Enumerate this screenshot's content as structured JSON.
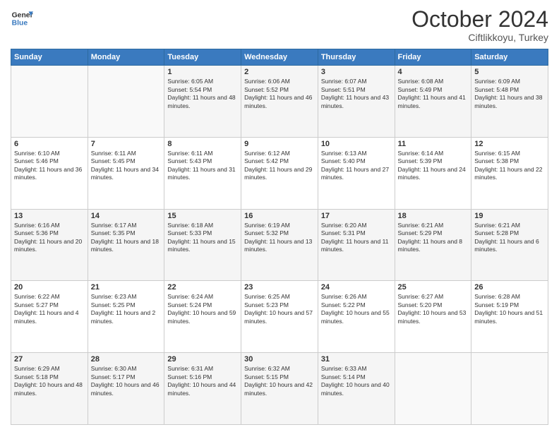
{
  "header": {
    "logo_line1": "General",
    "logo_line2": "Blue",
    "month": "October 2024",
    "location": "Ciftlikkoyu, Turkey"
  },
  "days_of_week": [
    "Sunday",
    "Monday",
    "Tuesday",
    "Wednesday",
    "Thursday",
    "Friday",
    "Saturday"
  ],
  "weeks": [
    [
      {
        "num": "",
        "info": ""
      },
      {
        "num": "",
        "info": ""
      },
      {
        "num": "1",
        "info": "Sunrise: 6:05 AM\nSunset: 5:54 PM\nDaylight: 11 hours and 48 minutes."
      },
      {
        "num": "2",
        "info": "Sunrise: 6:06 AM\nSunset: 5:52 PM\nDaylight: 11 hours and 46 minutes."
      },
      {
        "num": "3",
        "info": "Sunrise: 6:07 AM\nSunset: 5:51 PM\nDaylight: 11 hours and 43 minutes."
      },
      {
        "num": "4",
        "info": "Sunrise: 6:08 AM\nSunset: 5:49 PM\nDaylight: 11 hours and 41 minutes."
      },
      {
        "num": "5",
        "info": "Sunrise: 6:09 AM\nSunset: 5:48 PM\nDaylight: 11 hours and 38 minutes."
      }
    ],
    [
      {
        "num": "6",
        "info": "Sunrise: 6:10 AM\nSunset: 5:46 PM\nDaylight: 11 hours and 36 minutes."
      },
      {
        "num": "7",
        "info": "Sunrise: 6:11 AM\nSunset: 5:45 PM\nDaylight: 11 hours and 34 minutes."
      },
      {
        "num": "8",
        "info": "Sunrise: 6:11 AM\nSunset: 5:43 PM\nDaylight: 11 hours and 31 minutes."
      },
      {
        "num": "9",
        "info": "Sunrise: 6:12 AM\nSunset: 5:42 PM\nDaylight: 11 hours and 29 minutes."
      },
      {
        "num": "10",
        "info": "Sunrise: 6:13 AM\nSunset: 5:40 PM\nDaylight: 11 hours and 27 minutes."
      },
      {
        "num": "11",
        "info": "Sunrise: 6:14 AM\nSunset: 5:39 PM\nDaylight: 11 hours and 24 minutes."
      },
      {
        "num": "12",
        "info": "Sunrise: 6:15 AM\nSunset: 5:38 PM\nDaylight: 11 hours and 22 minutes."
      }
    ],
    [
      {
        "num": "13",
        "info": "Sunrise: 6:16 AM\nSunset: 5:36 PM\nDaylight: 11 hours and 20 minutes."
      },
      {
        "num": "14",
        "info": "Sunrise: 6:17 AM\nSunset: 5:35 PM\nDaylight: 11 hours and 18 minutes."
      },
      {
        "num": "15",
        "info": "Sunrise: 6:18 AM\nSunset: 5:33 PM\nDaylight: 11 hours and 15 minutes."
      },
      {
        "num": "16",
        "info": "Sunrise: 6:19 AM\nSunset: 5:32 PM\nDaylight: 11 hours and 13 minutes."
      },
      {
        "num": "17",
        "info": "Sunrise: 6:20 AM\nSunset: 5:31 PM\nDaylight: 11 hours and 11 minutes."
      },
      {
        "num": "18",
        "info": "Sunrise: 6:21 AM\nSunset: 5:29 PM\nDaylight: 11 hours and 8 minutes."
      },
      {
        "num": "19",
        "info": "Sunrise: 6:21 AM\nSunset: 5:28 PM\nDaylight: 11 hours and 6 minutes."
      }
    ],
    [
      {
        "num": "20",
        "info": "Sunrise: 6:22 AM\nSunset: 5:27 PM\nDaylight: 11 hours and 4 minutes."
      },
      {
        "num": "21",
        "info": "Sunrise: 6:23 AM\nSunset: 5:25 PM\nDaylight: 11 hours and 2 minutes."
      },
      {
        "num": "22",
        "info": "Sunrise: 6:24 AM\nSunset: 5:24 PM\nDaylight: 10 hours and 59 minutes."
      },
      {
        "num": "23",
        "info": "Sunrise: 6:25 AM\nSunset: 5:23 PM\nDaylight: 10 hours and 57 minutes."
      },
      {
        "num": "24",
        "info": "Sunrise: 6:26 AM\nSunset: 5:22 PM\nDaylight: 10 hours and 55 minutes."
      },
      {
        "num": "25",
        "info": "Sunrise: 6:27 AM\nSunset: 5:20 PM\nDaylight: 10 hours and 53 minutes."
      },
      {
        "num": "26",
        "info": "Sunrise: 6:28 AM\nSunset: 5:19 PM\nDaylight: 10 hours and 51 minutes."
      }
    ],
    [
      {
        "num": "27",
        "info": "Sunrise: 6:29 AM\nSunset: 5:18 PM\nDaylight: 10 hours and 48 minutes."
      },
      {
        "num": "28",
        "info": "Sunrise: 6:30 AM\nSunset: 5:17 PM\nDaylight: 10 hours and 46 minutes."
      },
      {
        "num": "29",
        "info": "Sunrise: 6:31 AM\nSunset: 5:16 PM\nDaylight: 10 hours and 44 minutes."
      },
      {
        "num": "30",
        "info": "Sunrise: 6:32 AM\nSunset: 5:15 PM\nDaylight: 10 hours and 42 minutes."
      },
      {
        "num": "31",
        "info": "Sunrise: 6:33 AM\nSunset: 5:14 PM\nDaylight: 10 hours and 40 minutes."
      },
      {
        "num": "",
        "info": ""
      },
      {
        "num": "",
        "info": ""
      }
    ]
  ]
}
